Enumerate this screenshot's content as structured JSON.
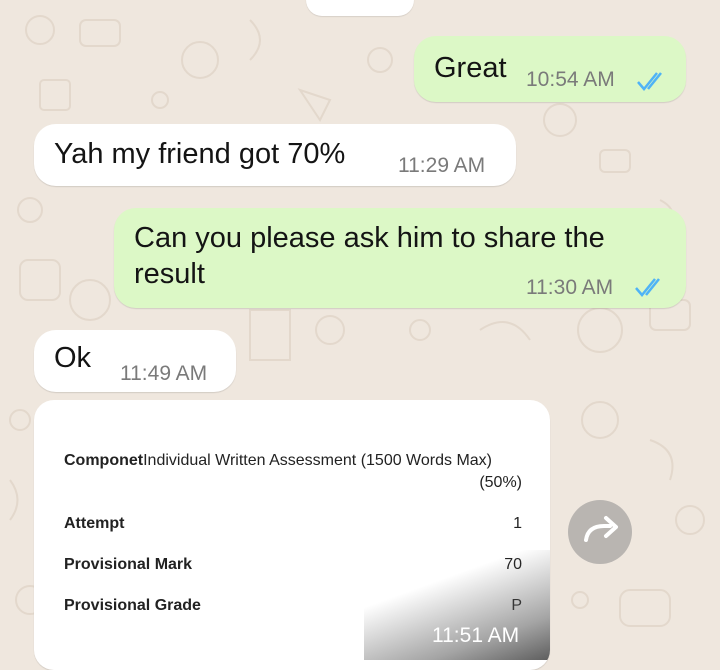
{
  "messages": [
    {
      "direction": "out",
      "text": "Great",
      "time": "10:54 AM",
      "read_icon": "double-check-icon"
    },
    {
      "direction": "in",
      "text": "Yah my friend got 70%",
      "time": "11:29 AM"
    },
    {
      "direction": "out",
      "text": "Can you please ask him to share the result",
      "time": "11:30 AM",
      "read_icon": "double-check-icon"
    },
    {
      "direction": "in",
      "text": "Ok",
      "time": "11:49 AM"
    }
  ],
  "image_message": {
    "time": "11:51 AM",
    "component_label": "Componet",
    "component_value": "Individual Written Assessment (1500 Words Max)",
    "component_weight": "(50%)",
    "rows": [
      {
        "label": "Attempt",
        "value": "1"
      },
      {
        "label": "Provisional Mark",
        "value": "70"
      },
      {
        "label": "Provisional Grade",
        "value": "P"
      }
    ]
  },
  "forward_button": {
    "icon": "forward-arrow-icon"
  },
  "colors": {
    "outgoing": "#dcf8c6",
    "incoming": "#ffffff",
    "read_ticks": "#4fb3f6",
    "background": "#efe7de"
  }
}
